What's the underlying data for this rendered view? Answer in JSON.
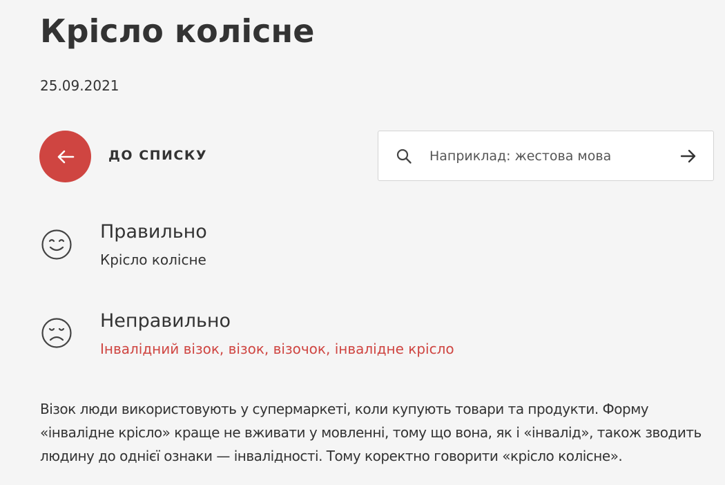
{
  "page": {
    "title": "Крісло колісне",
    "date": "25.09.2021"
  },
  "navigation": {
    "back_label": "ДО СПИСКУ",
    "back_icon": "arrow-left-icon"
  },
  "search": {
    "placeholder": "Наприклад: жестова мова",
    "value": "",
    "search_icon": "search-icon",
    "submit_icon": "arrow-right-icon"
  },
  "correct": {
    "heading": "Правильно",
    "text": "Крісло колісне",
    "icon": "smiling-face-icon"
  },
  "incorrect": {
    "heading": "Неправильно",
    "text": "Інвалідний візок, візок, візочок, інвалідне крісло",
    "icon": "sad-face-icon"
  },
  "description": "Візок люди використовують у супермаркеті, коли купують товари та продукти. Форму «інвалідне крісло» краще не вживати у мовленні, тому що вона, як і «інвалід», також зводить людину до однієї ознаки — інвалідності. Тому коректно говорити «крісло колісне».",
  "colors": {
    "accent": "#cf4541",
    "text": "#333333",
    "background": "#f5f5f5",
    "search_background": "#ffffff",
    "search_border": "#d3d3d3"
  }
}
